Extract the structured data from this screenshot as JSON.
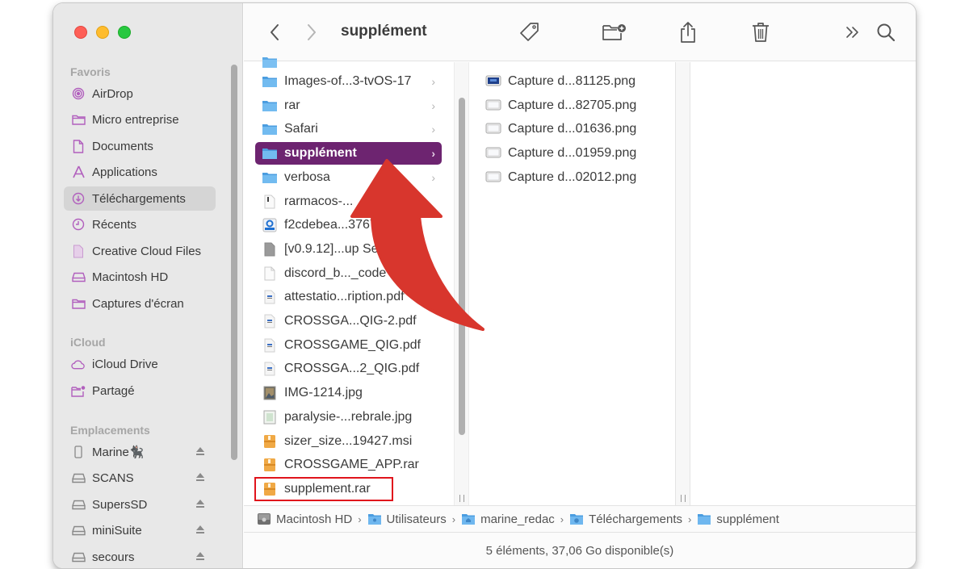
{
  "window": {
    "title": "supplément",
    "accent_color": "#6d2470",
    "sidebar_icon_color": "#b15fbd"
  },
  "toolbar": {
    "back_icon": "chevron-left-icon",
    "forward_icon": "chevron-right-icon",
    "title": "supplément",
    "buttons": [
      {
        "name": "tag",
        "icon": "tag-icon"
      },
      {
        "name": "new-folder",
        "icon": "folder-plus-icon"
      },
      {
        "name": "share",
        "icon": "share-icon"
      },
      {
        "name": "trash",
        "icon": "trash-icon"
      },
      {
        "name": "more",
        "icon": "double-chevron-icon",
        "label": "»"
      },
      {
        "name": "search",
        "icon": "search-icon"
      }
    ]
  },
  "sidebar": {
    "sections": [
      {
        "title": "Favoris",
        "items": [
          {
            "label": "AirDrop",
            "icon": "airdrop-icon"
          },
          {
            "label": "Micro entreprise",
            "icon": "folder-icon"
          },
          {
            "label": "Documents",
            "icon": "document-icon"
          },
          {
            "label": "Applications",
            "icon": "applications-icon"
          },
          {
            "label": "Téléchargements",
            "icon": "download-icon",
            "active": true
          },
          {
            "label": "Récents",
            "icon": "clock-icon"
          },
          {
            "label": "Creative Cloud Files",
            "icon": "file-icon"
          },
          {
            "label": "Macintosh HD",
            "icon": "drive-icon"
          },
          {
            "label": "Captures d'écran",
            "icon": "folder-icon"
          }
        ]
      },
      {
        "title": "iCloud",
        "items": [
          {
            "label": "iCloud Drive",
            "icon": "cloud-icon"
          },
          {
            "label": "Partagé",
            "icon": "shared-folder-icon"
          }
        ]
      },
      {
        "title": "Emplacements",
        "items": [
          {
            "label": "Marine🐈‍⬛",
            "icon": "phone-icon",
            "eject": true
          },
          {
            "label": "SCANS",
            "icon": "drive-icon",
            "eject": true
          },
          {
            "label": "SupersSD",
            "icon": "drive-icon",
            "eject": true
          },
          {
            "label": "miniSuite",
            "icon": "drive-icon",
            "eject": true
          },
          {
            "label": "secours",
            "icon": "drive-icon",
            "eject": true
          }
        ]
      }
    ]
  },
  "column1": {
    "items": [
      {
        "label": "Images-of...3-tvOS-17",
        "type": "folder",
        "chevron": true
      },
      {
        "label": "rar",
        "type": "folder",
        "chevron": true
      },
      {
        "label": "Safari",
        "type": "folder",
        "chevron": true
      },
      {
        "label": "supplément",
        "type": "folder",
        "chevron": true,
        "selected": true
      },
      {
        "label": "verbosa",
        "type": "folder",
        "chevron": true
      },
      {
        "label": "rarmacos-...",
        "type": "exec"
      },
      {
        "label": "f2cdebea...3767...b3",
        "type": "app"
      },
      {
        "label": "[v0.9.12]...up Setup.bat",
        "type": "doc-gray"
      },
      {
        "label": "discord_b..._code",
        "type": "doc"
      },
      {
        "label": "attestatio...ription.pdf",
        "type": "pdf"
      },
      {
        "label": "CROSSGA...QIG-2.pdf",
        "type": "pdf"
      },
      {
        "label": "CROSSGAME_QIG.pdf",
        "type": "pdf"
      },
      {
        "label": "CROSSGA...2_QIG.pdf",
        "type": "pdf"
      },
      {
        "label": "IMG-1214.jpg",
        "type": "image"
      },
      {
        "label": "paralysie-...rebrale.jpg",
        "type": "image-light"
      },
      {
        "label": "sizer_size...19427.msi",
        "type": "archive"
      },
      {
        "label": "CROSSGAME_APP.rar",
        "type": "archive"
      },
      {
        "label": "supplement.rar",
        "type": "archive",
        "boxed": true
      }
    ]
  },
  "column2": {
    "items": [
      {
        "label": "Capture d...81125.png",
        "type": "screenshot-dark"
      },
      {
        "label": "Capture d...82705.png",
        "type": "screenshot"
      },
      {
        "label": "Capture d...01636.png",
        "type": "screenshot"
      },
      {
        "label": "Capture d...01959.png",
        "type": "screenshot"
      },
      {
        "label": "Capture d...02012.png",
        "type": "screenshot"
      }
    ]
  },
  "pathbar": {
    "crumbs": [
      {
        "label": "Macintosh HD",
        "icon": "hard-drive-icon"
      },
      {
        "label": "Utilisateurs",
        "icon": "users-folder-icon"
      },
      {
        "label": "marine_redac",
        "icon": "home-folder-icon"
      },
      {
        "label": "Téléchargements",
        "icon": "downloads-folder-icon"
      },
      {
        "label": "supplément",
        "icon": "folder-icon"
      }
    ],
    "separator": "›"
  },
  "status": {
    "text": "5 éléments, 37,06 Go disponible(s)"
  },
  "annotation": {
    "arrow_color": "#d8362d",
    "box_color": "#e0141c"
  }
}
